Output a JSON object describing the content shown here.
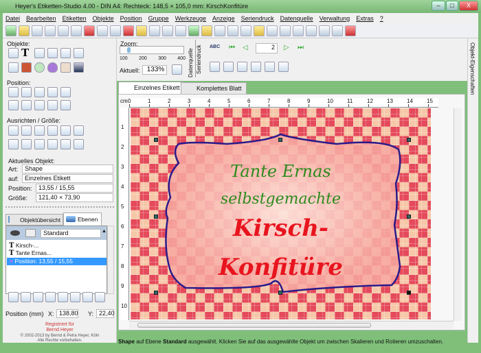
{
  "window": {
    "title": "Heyer's Etiketten-Studio 4.00 - DIN A4: Rechteck: 148,5 × 105,0 mm: KirschKonfitüre",
    "minimize": "–",
    "maximize": "□",
    "close": "X"
  },
  "menu": [
    "Datei",
    "Bearbeiten",
    "Etiketten",
    "Objekte",
    "Position",
    "Gruppe",
    "Werkzeuge",
    "Anzeige",
    "Seriendruck",
    "Datenquelle",
    "Verwaltung",
    "Extras",
    "?"
  ],
  "left": {
    "objects_label": "Objekte:",
    "position_label": "Position:",
    "align_label": "Ausrichten / Größe:",
    "current_object_label": "Aktuelles Objekt:",
    "art_label": "Art:",
    "art_value": "Shape",
    "auf_label": "auf:",
    "auf_value": "Einzelnes Etikett",
    "pos_label": "Position:",
    "pos_value": "13,55 / 15,55",
    "size_label": "Größe:",
    "size_value": "121,40 × 73,90",
    "tabs": [
      "Objektübersicht",
      "Ebenen"
    ],
    "layer_select": "Standard",
    "layer_items": [
      "Kirsch-...",
      "Tante Ernas...",
      "Position: 13,55 / 15,55"
    ],
    "posmm_label": "Position (mm)",
    "x_label": "X:",
    "x_value": "138,80",
    "y_label": "Y:",
    "y_value": "22,40",
    "registered": "Registriert für",
    "registered_name": "Bernd Heyer",
    "copyright": "© 2002-2013 by Bernd & Petra Heyer, Köln",
    "rights": "Alle Rechte vorbehalten."
  },
  "zoom": {
    "label": "Zoom:",
    "ticks": [
      "100",
      "200",
      "300",
      "400"
    ],
    "current_label": "Aktuell:",
    "current_value": "133%",
    "slider_fraction": 0.11
  },
  "side_tabs": [
    "Datenquelle",
    "Seriendruck"
  ],
  "record": {
    "value": "2",
    "abc": "ABC"
  },
  "doc_tabs": [
    "Einzelnes Etikett",
    "Komplettes Blatt"
  ],
  "ruler": {
    "unit": "cm",
    "h": [
      "0",
      "1",
      "2",
      "3",
      "4",
      "5",
      "6",
      "7",
      "8",
      "9",
      "10",
      "11",
      "12",
      "13",
      "14",
      "15"
    ],
    "v": [
      "1",
      "2",
      "3",
      "4",
      "5",
      "6",
      "7",
      "8",
      "9",
      "10"
    ]
  },
  "label_text": {
    "line1": "Tante Ernas",
    "line2": "selbstgemachte",
    "line3": "Kirsch-",
    "line4": "Konfitüre"
  },
  "colors": {
    "green_text": "#2e8a1e",
    "red_text": "#e8141e",
    "outline": "#2a1a8a"
  },
  "right_panel": "Objekt-Eigenschaften",
  "status": {
    "b1": "Shape",
    "t1": " auf Ebene ",
    "b2": "Standard",
    "t2": " ausgewählt.  Klicken Sie auf das ausgewählte Objekt um zwischen Skalieren und Rotieren umzuschalten."
  }
}
